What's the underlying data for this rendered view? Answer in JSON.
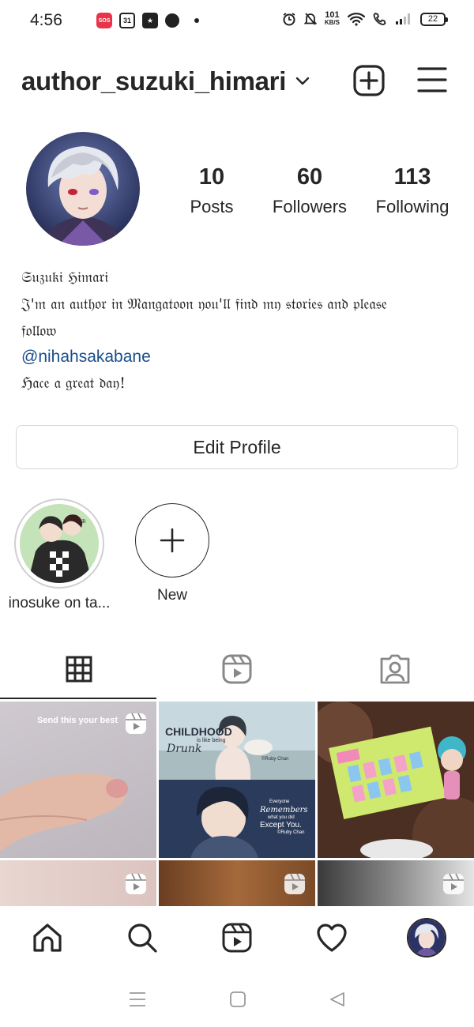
{
  "status_bar": {
    "time": "4:56",
    "sos_label": "SOS",
    "calendar_day": "31",
    "speed_value": "101",
    "speed_unit": "KB/S",
    "battery": "22"
  },
  "header": {
    "username": "author_suzuki_himari"
  },
  "profile": {
    "stats": [
      {
        "value": "10",
        "label": "Posts"
      },
      {
        "value": "60",
        "label": "Followers"
      },
      {
        "value": "113",
        "label": "Following"
      }
    ],
    "bio": {
      "name": "𝔖𝔲𝔷𝔲𝔨𝔦 ℌ𝔦𝔪𝔞𝔯𝔦",
      "line1": "𝔍'𝔪 𝔞𝔫 𝔞𝔲𝔱𝔥𝔬𝔯 𝔦𝔫 𝔐𝔞𝔫𝔤𝔞𝔱𝔬𝔬𝔫 𝔶𝔬𝔲'𝔩𝔩 𝔣𝔦𝔫𝔡 𝔪𝔶 𝔰𝔱𝔬𝔯𝔦𝔢𝔰 𝔞𝔫𝔡 𝔭𝔩𝔢𝔞𝔰𝔢",
      "line2": "𝔣𝔬𝔩𝔩𝔬𝔴",
      "mention": "@nihahsakabane",
      "line3": "ℌ𝔞𝔠𝔢 𝔞 𝔤𝔯𝔢𝔞𝔱 𝔡𝔞𝔶!"
    },
    "edit_button": "Edit Profile"
  },
  "highlights": [
    {
      "label": "inosuke on ta..."
    },
    {
      "label": "New"
    }
  ],
  "grid": {
    "tile1_caption": "Send this your best",
    "tile2_top_title": "CHILDHOOD",
    "tile2_top_sub": "is like being",
    "tile2_top_script": "Drunk",
    "tile2_top_credit": "©Ruby Chan",
    "tile2_bottom_line1": "Everyone",
    "tile2_bottom_line2": "Remembers",
    "tile2_bottom_line3": "what you did",
    "tile2_bottom_line4": "Except You.",
    "tile2_bottom_credit": "©Ruby Chan"
  },
  "icons": {
    "header": [
      "new-post-icon",
      "menu-icon",
      "chevron-down-icon"
    ],
    "tabs": [
      "grid-icon",
      "reels-icon",
      "tagged-icon"
    ],
    "bottom_nav": [
      "home-icon",
      "search-icon",
      "reels-icon",
      "heart-icon",
      "profile-avatar"
    ],
    "system_nav": [
      "recents-icon",
      "home-square-icon",
      "back-triangle-icon"
    ]
  },
  "colors": {
    "text": "#262626",
    "link": "#1a4d8a",
    "border": "#d6d6d6"
  }
}
